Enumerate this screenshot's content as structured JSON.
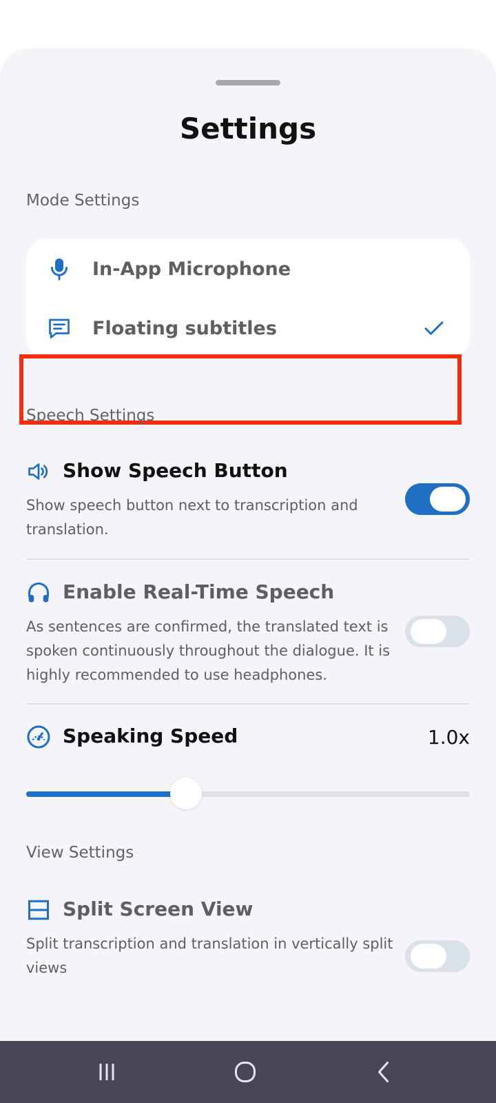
{
  "header": {
    "title": "Settings"
  },
  "mode_settings": {
    "label": "Mode Settings",
    "items": [
      {
        "label": "In-App Microphone",
        "icon": "microphone-icon",
        "selected": false
      },
      {
        "label": "Floating subtitles",
        "icon": "subtitles-icon",
        "selected": true
      }
    ]
  },
  "speech_settings": {
    "label": "Speech Settings",
    "show_speech_button": {
      "title": "Show Speech Button",
      "description": "Show speech button next to transcription and translation.",
      "icon": "speaker-icon",
      "enabled": true
    },
    "real_time_speech": {
      "title": "Enable Real-Time Speech",
      "description": "As sentences are confirmed, the translated text is spoken continuously throughout the dialogue. It is highly recommended to use headphones.",
      "icon": "headphones-icon",
      "enabled": false
    },
    "speaking_speed": {
      "title": "Speaking Speed",
      "value_label": "1.0x",
      "icon": "speedometer-icon",
      "slider_fraction": 0.36
    }
  },
  "view_settings": {
    "label": "View Settings",
    "split_screen": {
      "title": "Split Screen View",
      "description": "Split transcription and translation in vertically split views",
      "icon": "split-view-icon",
      "enabled": false
    }
  },
  "colors": {
    "accent": "#1f6fc5",
    "highlight": "#f42d0f",
    "navbar": "#474757"
  },
  "navbar": {
    "items": [
      "recent-apps-icon",
      "home-icon",
      "back-icon"
    ]
  }
}
